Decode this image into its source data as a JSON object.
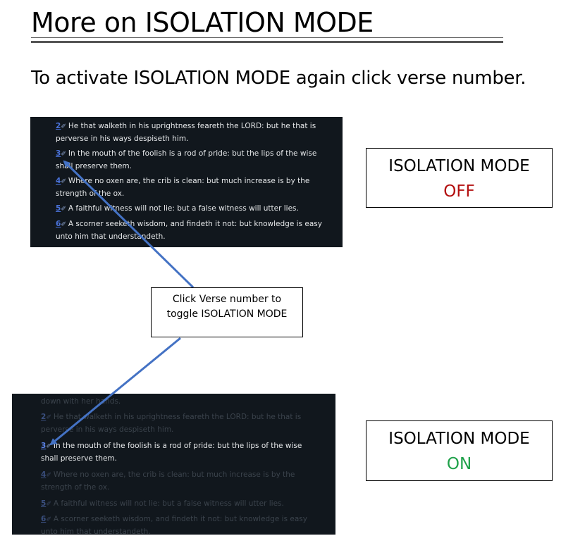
{
  "title": "More on ISOLATION MODE",
  "subtitle": "To activate ISOLATION MODE again click verse number.",
  "screenshot_off": {
    "verses": [
      {
        "num": "2",
        "line1": "He that walketh in his uprightness feareth the LORD: but he that is",
        "line2": "perverse in his ways despiseth him."
      },
      {
        "num": "3",
        "line1": "In the mouth of the foolish is a rod of pride: but the lips of the wise",
        "line2": "shall preserve them."
      },
      {
        "num": "4",
        "line1": "Where no oxen are, the crib is clean: but much increase is by the",
        "line2": "strength of the ox."
      },
      {
        "num": "5",
        "line1": "A faithful witness will not lie: but a false witness will utter lies.",
        "line2": ""
      },
      {
        "num": "6",
        "line1": "A scorner seeketh wisdom, and findeth it not: but knowledge is easy",
        "line2": "unto him that understandeth."
      }
    ]
  },
  "screenshot_on": {
    "top_partial": "down with her hands.",
    "verses": [
      {
        "num": "2",
        "line1": "He that walketh in his uprightness feareth the LORD: but he that is",
        "line2": "perverse in his ways despiseth him."
      },
      {
        "num": "3",
        "line1": "In the mouth of the foolish is a rod of pride: but the lips of the wise",
        "line2": "shall preserve them."
      },
      {
        "num": "4",
        "line1": "Where no oxen are, the crib is clean: but much increase is by the",
        "line2": "strength of the ox."
      },
      {
        "num": "5",
        "line1": "A faithful witness will not lie: but a false witness will utter lies.",
        "line2": ""
      },
      {
        "num": "6",
        "line1": "A scorner seeketh wisdom, and findeth it not: but knowledge is easy",
        "line2": "unto him that understandeth."
      }
    ]
  },
  "state_off": {
    "label": "ISOLATION MODE",
    "value": "OFF"
  },
  "state_on": {
    "label": "ISOLATION MODE",
    "value": "ON"
  },
  "callout": {
    "line1": "Click Verse number to",
    "line2": "toggle ISOLATION MODE"
  },
  "pin_glyph": "✐",
  "colors": {
    "off": "#b30f0f",
    "on": "#1fa14a",
    "arrow": "#4472c4",
    "verse_number": "#4a72d9",
    "panel_bg": "#11171d"
  }
}
